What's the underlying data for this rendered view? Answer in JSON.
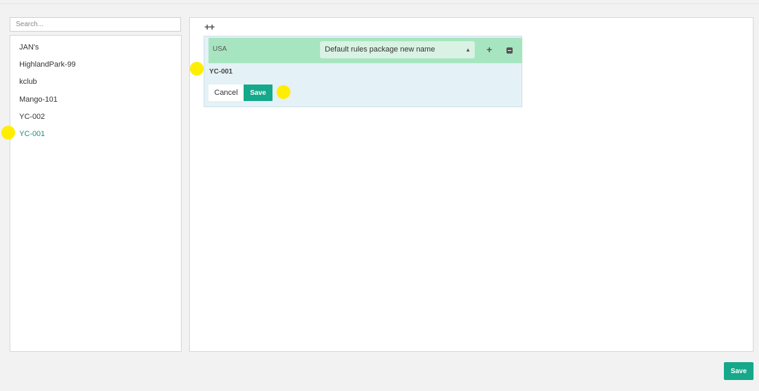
{
  "search": {
    "placeholder": "Search..."
  },
  "sidebar": {
    "items": [
      {
        "label": "JAN's"
      },
      {
        "label": "HighlandPark-99"
      },
      {
        "label": "kclub"
      },
      {
        "label": "Mango-101"
      },
      {
        "label": "YC-002"
      },
      {
        "label": "YC-001",
        "selected": true
      }
    ]
  },
  "main": {
    "expand_all_icon": "double-plus-icon",
    "expand_all_label": "++",
    "card": {
      "country": "USA",
      "package_select": {
        "value": "Default rules package new name"
      },
      "add_icon_label": "+",
      "title": "YC-001",
      "cancel_label": "Cancel",
      "save_label": "Save"
    }
  },
  "footer": {
    "save_label": "Save"
  },
  "colors": {
    "accent": "#15a88a",
    "selected_text": "#1a8f7e",
    "card_header": "#a7e5c1",
    "card_body": "#e4f1f6",
    "marker": "#ffee00"
  }
}
